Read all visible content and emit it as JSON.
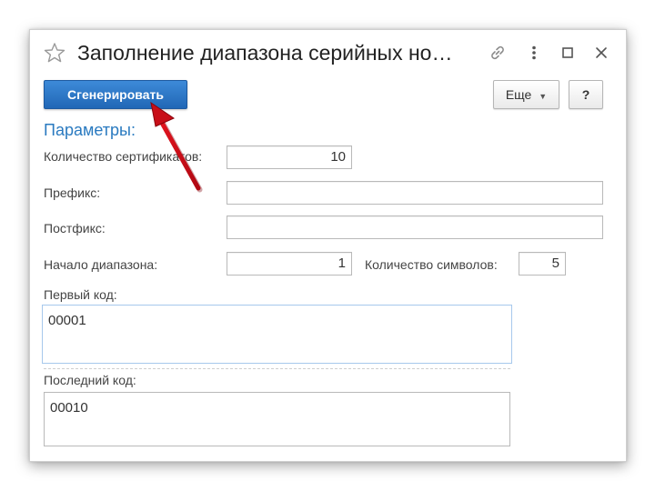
{
  "window": {
    "title": "Заполнение диапазона серийных но…",
    "icons": [
      "star-icon",
      "link-icon",
      "more-vert-icon",
      "maximize-icon",
      "close-icon"
    ]
  },
  "toolbar": {
    "generate_label": "Сгенерировать",
    "more_label": "Еще",
    "help_label": "?"
  },
  "section": {
    "title": "Параметры:"
  },
  "fields": {
    "count_label": "Количество сертификатов:",
    "count_value": "10",
    "prefix_label": "Префикс:",
    "prefix_value": "",
    "postfix_label": "Постфикс:",
    "postfix_value": "",
    "range_start_label": "Начало диапазона:",
    "range_start_value": "1",
    "symbols_label": "Количество символов:",
    "symbols_value": "5",
    "first_code_label": "Первый код:",
    "first_code_value": "00001",
    "last_code_label": "Последний код:",
    "last_code_value": "00010"
  },
  "colors": {
    "primary": "#2a72c4",
    "section_title": "#2a7ac0",
    "annotation_arrow": "#d0101a"
  }
}
